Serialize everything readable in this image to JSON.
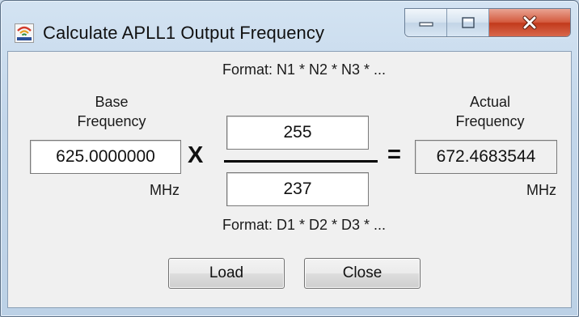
{
  "window": {
    "title": "Calculate APLL1 Output Frequency"
  },
  "base_frequency": {
    "label_line1": "Base",
    "label_line2": "Frequency",
    "value": "625.0000000",
    "unit": "MHz"
  },
  "multiply_symbol": "X",
  "equals_symbol": "=",
  "numerator": {
    "format_hint": "Format: N1 * N2 * N3 * ...",
    "value": "255"
  },
  "denominator": {
    "format_hint": "Format: D1 * D2 * D3 * ...",
    "value": "237"
  },
  "actual_frequency": {
    "label_line1": "Actual",
    "label_line2": "Frequency",
    "value": "672.4683544",
    "unit": "MHz"
  },
  "buttons": {
    "load": "Load",
    "close": "Close"
  },
  "colors": {
    "titlebar": "#c2d6ea",
    "close_button": "#c23a1c",
    "client_background": "#f0f0f0"
  }
}
